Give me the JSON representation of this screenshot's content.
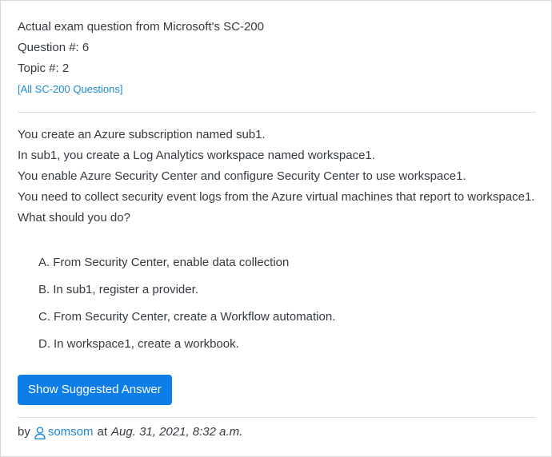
{
  "header": {
    "line1": "Actual exam question from Microsoft's SC-200",
    "line2": "Question #: 6",
    "line3": "Topic #: 2",
    "all_questions_link": "[All SC-200 Questions]"
  },
  "question": {
    "lines": [
      "You create an Azure subscription named sub1.",
      "In sub1, you create a Log Analytics workspace named workspace1.",
      "You enable Azure Security Center and configure Security Center to use workspace1.",
      "You need to collect security event logs from the Azure virtual machines that report to workspace1.",
      "What should you do?"
    ]
  },
  "choices": [
    {
      "letter": "A.",
      "text": "From Security Center, enable data collection"
    },
    {
      "letter": "B.",
      "text": "In sub1, register a provider."
    },
    {
      "letter": "C.",
      "text": "From Security Center, create a Workflow automation."
    },
    {
      "letter": "D.",
      "text": "In workspace1, create a workbook."
    }
  ],
  "answer_button": {
    "label": "Show Suggested Answer"
  },
  "footer": {
    "by": "by",
    "username": "somsom",
    "at": "at",
    "date": "Aug. 31, 2021, 8:32 a.m."
  },
  "colors": {
    "accent": "#0d7de8",
    "link": "#1a8ad6",
    "text": "#343a40"
  },
  "icons": {
    "user": "user-icon"
  }
}
